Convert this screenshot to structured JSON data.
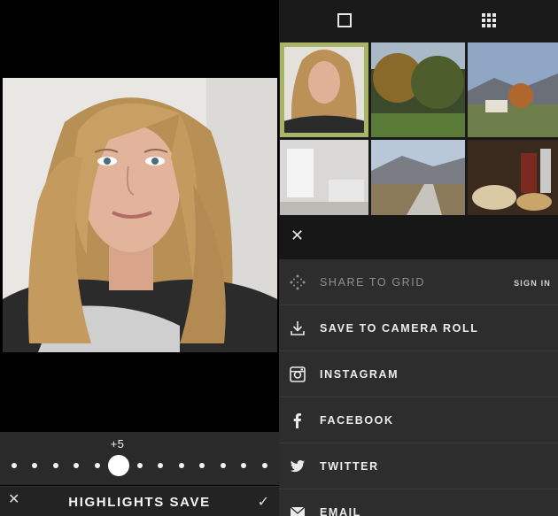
{
  "editor": {
    "slider_value": "+5",
    "tool_title": "HIGHLIGHTS SAVE",
    "close_icon": "close-icon",
    "confirm_icon": "checkmark-icon",
    "slider_level": 5
  },
  "gallery": {
    "view_single_icon": "single-view-icon",
    "view_grid_icon": "grid-view-icon",
    "thumbnails": [
      "portrait",
      "autumn-trees",
      "village-mountains",
      "desk-computer",
      "mountain-road",
      "food-table"
    ],
    "selected_index": 0,
    "selected_color": "#a8b567"
  },
  "share": {
    "close_icon": "close-icon",
    "items": [
      {
        "label": "SHARE TO GRID",
        "aside": "SIGN IN",
        "icon": "grid-move-icon"
      },
      {
        "label": "SAVE TO CAMERA ROLL",
        "icon": "download-icon"
      },
      {
        "label": "INSTAGRAM",
        "icon": "instagram-icon"
      },
      {
        "label": "FACEBOOK",
        "icon": "facebook-icon"
      },
      {
        "label": "TWITTER",
        "icon": "twitter-icon"
      },
      {
        "label": "EMAIL",
        "icon": "mail-icon"
      }
    ]
  }
}
